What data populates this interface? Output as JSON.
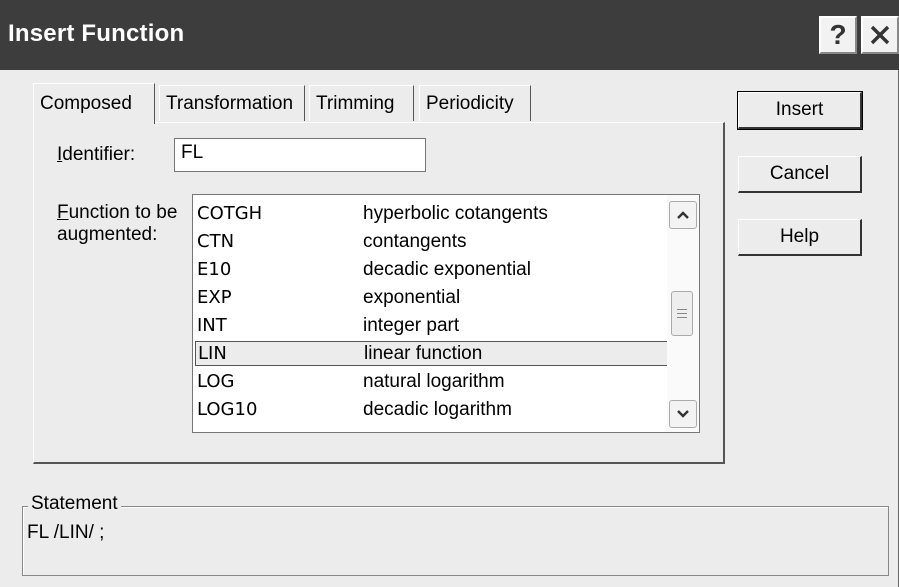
{
  "window": {
    "title": "Insert Function",
    "help_glyph": "?",
    "close_glyph": "X"
  },
  "tabs": [
    {
      "label": "Composed",
      "active": true
    },
    {
      "label": "Transformation",
      "active": false
    },
    {
      "label": "Trimming",
      "active": false
    },
    {
      "label": "Periodicity",
      "active": false
    }
  ],
  "identifier": {
    "label_prefix": "I",
    "label_rest": "dentifier:",
    "value": "FL"
  },
  "function_list": {
    "label_line1_prefix": "F",
    "label_line1_rest": "unction to be",
    "label_line2": "augmented:",
    "rows": [
      {
        "code": "COTGH",
        "desc": "hyperbolic cotangents",
        "selected": false
      },
      {
        "code": "CTN",
        "desc": "contangents",
        "selected": false
      },
      {
        "code": "E10",
        "desc": "decadic exponential",
        "selected": false
      },
      {
        "code": "EXP",
        "desc": "exponential",
        "selected": false
      },
      {
        "code": "INT",
        "desc": "integer part",
        "selected": false
      },
      {
        "code": "LIN",
        "desc": "linear function",
        "selected": true
      },
      {
        "code": "LOG",
        "desc": "natural logarithm",
        "selected": false
      },
      {
        "code": "LOG10",
        "desc": "decadic logarithm",
        "selected": false
      }
    ]
  },
  "buttons": {
    "insert": "Insert",
    "cancel": "Cancel",
    "help": "Help"
  },
  "statement": {
    "group_title": "Statement",
    "text": "FL /LIN/ ;"
  },
  "colors": {
    "titlebar": "#3d3d3d",
    "dialog_bg": "#ececec"
  }
}
